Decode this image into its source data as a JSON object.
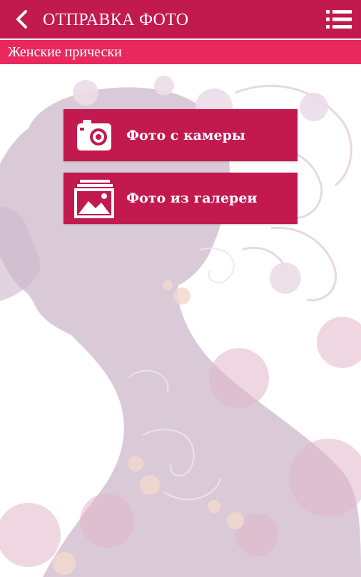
{
  "header": {
    "title": "ОТПРАВКА ФОТО",
    "back_icon": "chevron-left-icon",
    "menu_icon": "list-menu-icon"
  },
  "subheader": {
    "label": "Женские прически"
  },
  "actions": [
    {
      "label": "Фото с камеры",
      "icon": "camera-icon"
    },
    {
      "label": "Фото из галереи",
      "icon": "gallery-image-icon"
    }
  ],
  "colors": {
    "appbar": "#c2194e",
    "subbar": "#e8285f",
    "button": "#c2194e",
    "silhouette": "#d8c7d6",
    "text": "#ffffff"
  }
}
